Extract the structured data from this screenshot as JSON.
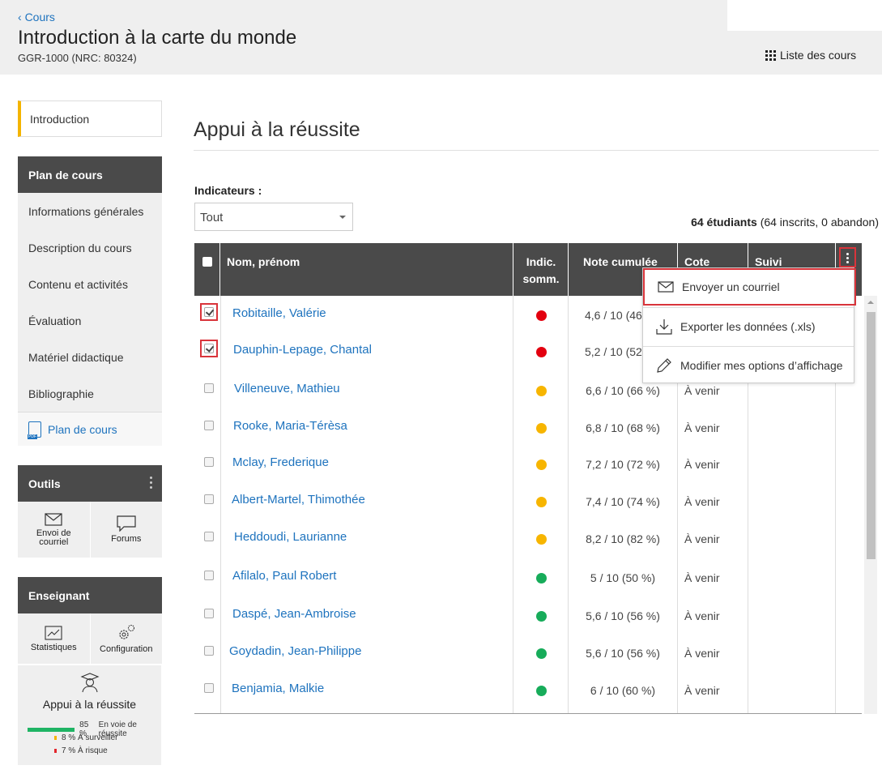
{
  "header": {
    "back_label": "Cours",
    "course_title": "Introduction à la carte du monde",
    "course_code": "GGR-1000 (NRC: 80324)",
    "list_button": "Liste des cours"
  },
  "sidebar": {
    "intro": "Introduction",
    "plan_header": "Plan de cours",
    "plan_items": [
      "Informations générales",
      "Description du cours",
      "Contenu et activités",
      "Évaluation",
      "Matériel didactique",
      "Bibliographie"
    ],
    "plan_pdf": "Plan de cours",
    "tools_header": "Outils",
    "tool_email": "Envoi de courriel",
    "tool_forums": "Forums",
    "teacher_header": "Enseignant",
    "tool_stats": "Statistiques",
    "tool_config": "Configuration",
    "success_title": "Appui à la réussite",
    "legend": [
      {
        "pct": "85 %",
        "label": "En voie de réussite",
        "color": "#1fb464",
        "fraction": 0.85
      },
      {
        "pct": "8 %",
        "label": "À surveiller",
        "color": "#f4b400",
        "fraction": 0.08
      },
      {
        "pct": "7 %",
        "label": "À risque",
        "color": "#e3262c",
        "fraction": 0.07
      }
    ]
  },
  "main": {
    "title": "Appui à la réussite",
    "indicator_label": "Indicateurs :",
    "indicator_value": "Tout",
    "count_bold": "64 étudiants",
    "count_rest": "(64 inscrits, 0 abandon)",
    "columns": {
      "name": "Nom, prénom",
      "indic_1": "Indic.",
      "indic_2": "somm.",
      "note": "Note cumulée",
      "cote": "Cote",
      "suivi": "Suivi"
    },
    "colors": {
      "red": "#e3000f",
      "yellow": "#f7b500",
      "green": "#17ac5a"
    },
    "students": [
      {
        "name": "Robitaille, Valérie",
        "status": "red",
        "note": "4,6 / 10 (46",
        "cote": "",
        "checked": true
      },
      {
        "name": "Dauphin-Lepage, Chantal",
        "status": "red",
        "note": "5,2 / 10 (52",
        "cote": "",
        "checked": true
      },
      {
        "name": "Villeneuve, Mathieu",
        "status": "yellow",
        "note": "6,6 / 10 (66 %)",
        "cote": "À venir",
        "checked": false
      },
      {
        "name": "Rooke, Maria-Térèsa",
        "status": "yellow",
        "note": "6,8 / 10 (68 %)",
        "cote": "À venir",
        "checked": false
      },
      {
        "name": "Mclay, Frederique",
        "status": "yellow",
        "note": "7,2 / 10 (72 %)",
        "cote": "À venir",
        "checked": false
      },
      {
        "name": "Albert-Martel, Thimothée",
        "status": "yellow",
        "note": "7,4 / 10 (74 %)",
        "cote": "À venir",
        "checked": false
      },
      {
        "name": "Heddoudi, Laurianne",
        "status": "yellow",
        "note": "8,2 / 10 (82 %)",
        "cote": "À venir",
        "checked": false
      },
      {
        "name": "Afilalo, Paul Robert",
        "status": "green",
        "note": "5 / 10 (50 %)",
        "cote": "À venir",
        "checked": false
      },
      {
        "name": "Daspé, Jean-Ambroise",
        "status": "green",
        "note": "5,6 / 10 (56 %)",
        "cote": "À venir",
        "checked": false
      },
      {
        "name": "Goydadin, Jean-Philippe",
        "status": "green",
        "note": "5,6 / 10 (56 %)",
        "cote": "À venir",
        "checked": false
      },
      {
        "name": "Benjamia, Malkie",
        "status": "green",
        "note": "6 / 10 (60 %)",
        "cote": "À venir",
        "checked": false
      }
    ]
  },
  "menu": {
    "send_email": "Envoyer un courriel",
    "export": "Exporter les données (.xls)",
    "options": "Modifier mes options d’affichage"
  }
}
